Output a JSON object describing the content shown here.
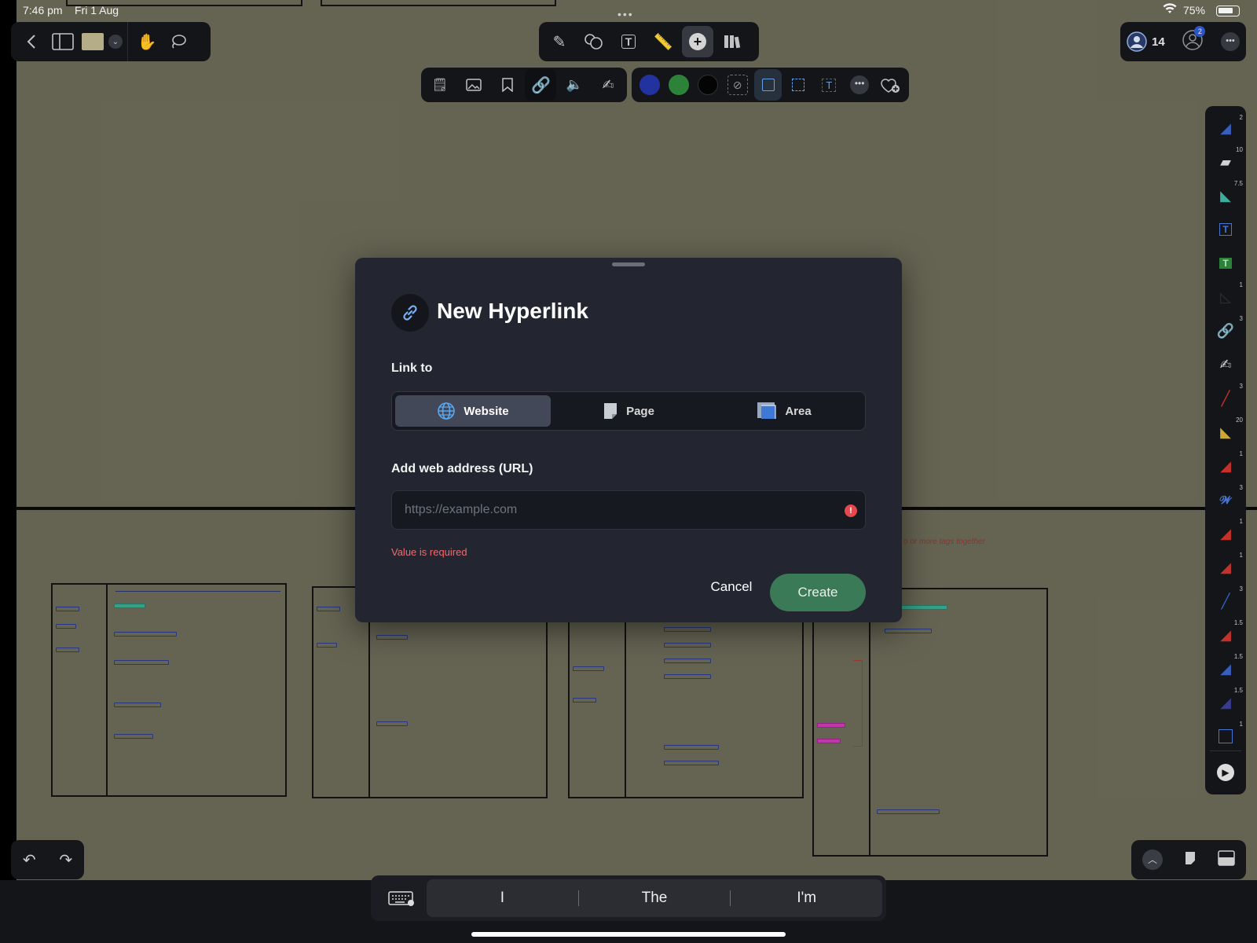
{
  "status_bar": {
    "time": "7:46 pm",
    "date": "Fri 1 Aug",
    "battery": "75%"
  },
  "collab": {
    "viewer_count": "14",
    "notification_count": "2"
  },
  "modal": {
    "title": "New Hyperlink",
    "link_to_label": "Link to",
    "options": [
      "Website",
      "Page",
      "Area"
    ],
    "selected_option": "Website",
    "url_label": "Add web address (URL)",
    "url_value": "",
    "url_placeholder": "https://example.com",
    "error_message": "Value is required",
    "cancel_label": "Cancel",
    "create_label": "Create"
  },
  "keyboard_predictions": [
    "I",
    "The",
    "I'm"
  ],
  "colors": {
    "blue": "#2435a8",
    "green": "#2f8a3c",
    "black": "#050505",
    "accent_create": "#3b7a57",
    "error": "#e5484d"
  },
  "side_palette_sizes": [
    "2",
    "10",
    "7.5",
    "1",
    "3",
    "3",
    "20",
    "1",
    "3",
    "1",
    "1",
    "3",
    "1.5",
    "1.5",
    "1.5",
    "1"
  ],
  "icons": {
    "toolbar_top": [
      "pen-icon",
      "shapes-icon",
      "text-box-icon",
      "ruler-icon",
      "plus-icon",
      "library-icon"
    ],
    "toolbar_insert": [
      "sticky-note-icon",
      "image-icon",
      "bookmark-icon",
      "link-icon",
      "audio-icon",
      "signature-icon"
    ]
  }
}
